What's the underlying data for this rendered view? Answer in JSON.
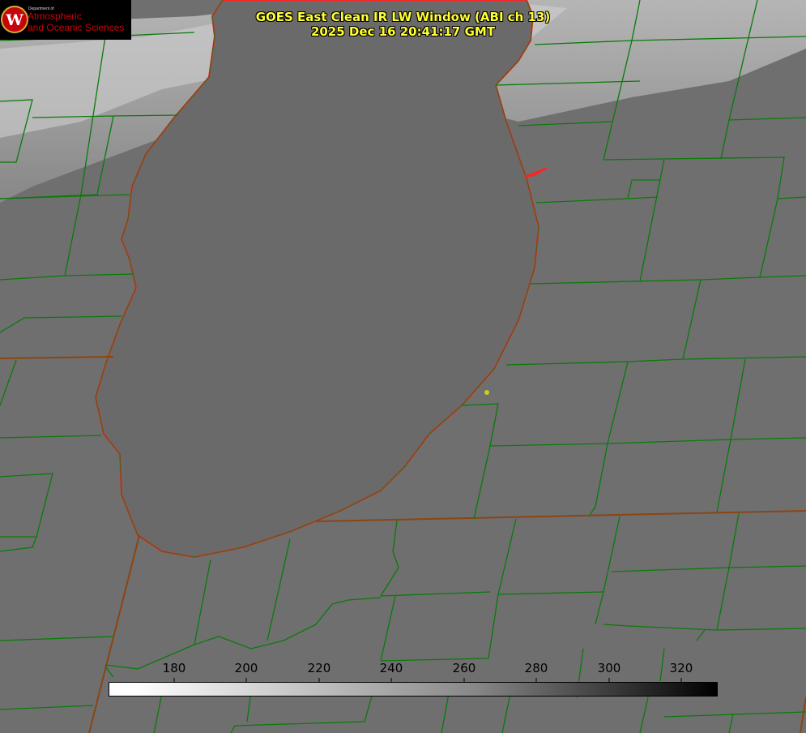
{
  "title": {
    "line1": "GOES East Clean IR LW Window (ABI ch 13)",
    "line2": "2025 Dec 16 20:41:17 GMT"
  },
  "logo": {
    "dept": "Department of",
    "line1": "Atmospheric",
    "line2": "and Oceanic Sciences",
    "letter": "W"
  },
  "colorbar": {
    "min": 162,
    "max": 330,
    "ticks": [
      "180",
      "200",
      "220",
      "240",
      "260",
      "280",
      "300",
      "320"
    ],
    "gradient": [
      "#ffffff",
      "#888888",
      "#000000"
    ]
  },
  "colors": {
    "county_lines": "#0a7a0a",
    "coastline": "#ff2020",
    "title_text": "#ffff33",
    "marker": "#cccc22"
  }
}
